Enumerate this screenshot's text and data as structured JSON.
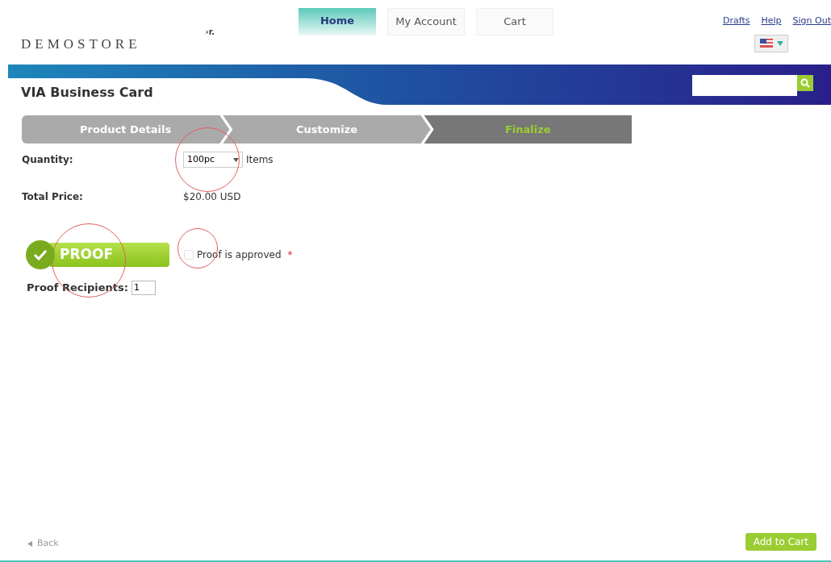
{
  "header": {
    "logo": "DEMOSTORE",
    "fragment": "›r.",
    "links": [
      "Drafts",
      "Help",
      "Sign Out"
    ]
  },
  "nav_tabs": [
    {
      "label": "Home",
      "selected": true
    },
    {
      "label": "My Account",
      "selected": false
    },
    {
      "label": "Cart",
      "selected": false
    }
  ],
  "product_title": "VIA Business Card",
  "steps": [
    {
      "label": "Product Details",
      "selected": false
    },
    {
      "label": "Customize",
      "selected": false
    },
    {
      "label": "Finalize",
      "selected": true
    }
  ],
  "quantity": {
    "label": "Quantity:",
    "value": "100pc",
    "unit": "Items",
    "highlighted": true
  },
  "total_price": {
    "label": "Total Price:",
    "value": "$20.00 USD"
  },
  "proof": {
    "badge": "PROOF",
    "badge_highlighted": true,
    "approved_label": "Proof is approved",
    "required_mark": "*",
    "checked": false,
    "checkbox_highlighted": true,
    "recipients_label": "Proof Recipients:",
    "recipients_value": "1"
  },
  "footer": {
    "back": "Back",
    "add_to_cart": "Add to Cart"
  }
}
